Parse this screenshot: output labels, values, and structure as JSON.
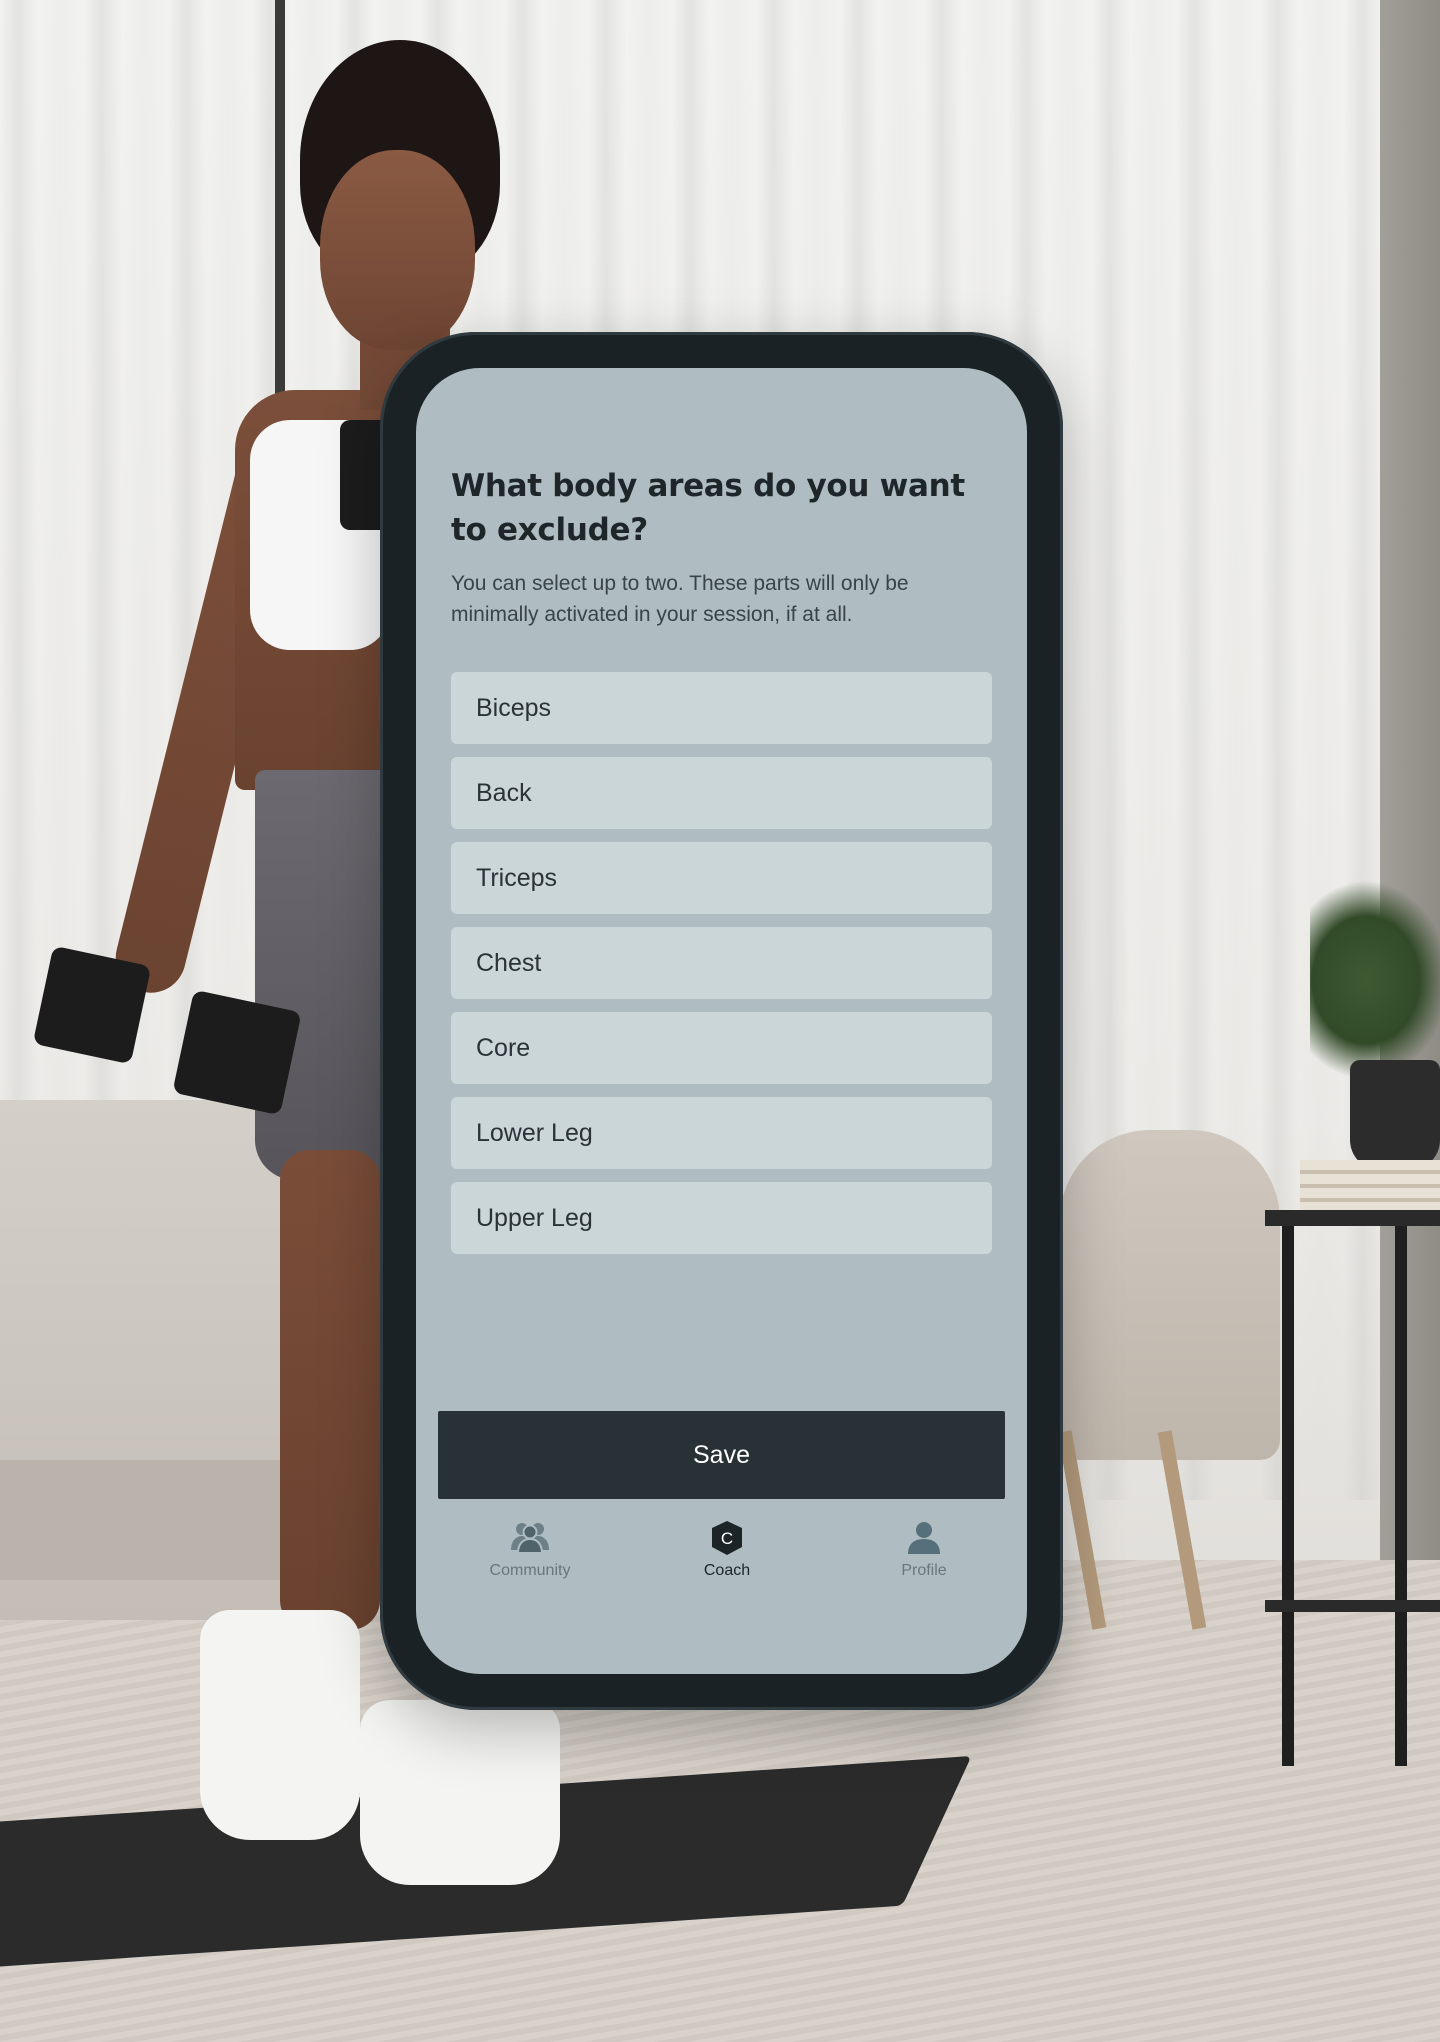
{
  "question": {
    "title": "What body areas do you want to exclude?",
    "subtitle": "You can select up to two. These parts will only be minimally activated in your session, if at all."
  },
  "options": [
    {
      "label": "Biceps"
    },
    {
      "label": "Back"
    },
    {
      "label": "Triceps"
    },
    {
      "label": "Chest"
    },
    {
      "label": "Core"
    },
    {
      "label": "Lower Leg"
    },
    {
      "label": "Upper Leg"
    }
  ],
  "actions": {
    "save_label": "Save"
  },
  "tabbar": {
    "items": [
      {
        "label": "Community",
        "icon": "community-icon",
        "active": false
      },
      {
        "label": "Coach",
        "icon": "coach-icon",
        "icon_letter": "C",
        "active": true
      },
      {
        "label": "Profile",
        "icon": "profile-icon",
        "active": false
      }
    ]
  },
  "colors": {
    "screen_bg": "#afbdc3",
    "option_bg": "#cbd6d8",
    "button_bg": "#283136",
    "phone_frame": "#1a2225"
  }
}
